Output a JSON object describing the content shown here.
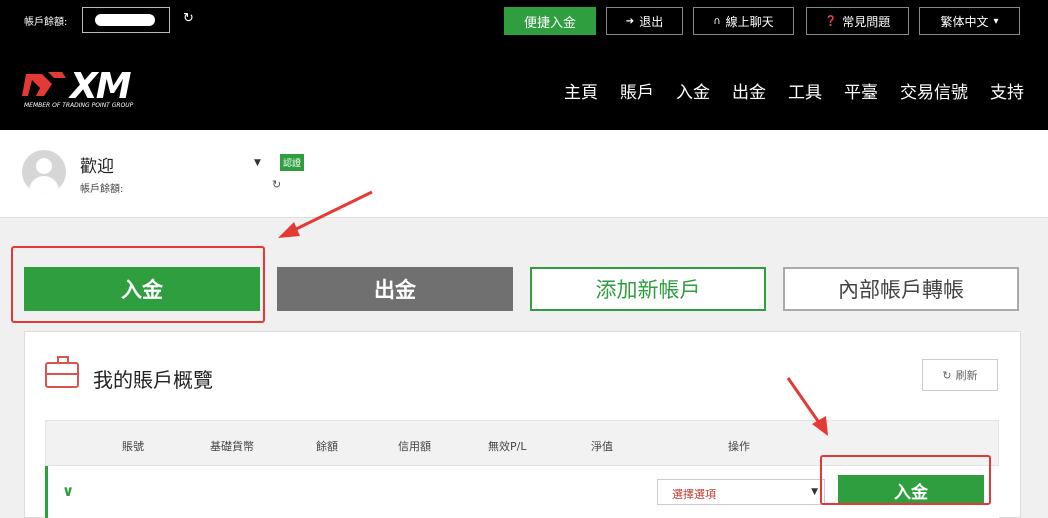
{
  "topbar": {
    "balance_label": "帳戶餘額:",
    "refresh_icon": "refresh-icon",
    "quick_deposit": "便捷入金",
    "logout": "退出",
    "logout_icon": "logout-icon",
    "live_chat": "線上聊天",
    "live_chat_icon": "headset-icon",
    "faq": "常見問題",
    "faq_icon": "question-icon",
    "language": "繁体中文"
  },
  "brand": {
    "logo_text": "XM",
    "tagline": "MEMBER OF TRADING POINT GROUP",
    "accent": "#e53935"
  },
  "nav": {
    "items": [
      "主頁",
      "賬戶",
      "入金",
      "出金",
      "工具",
      "平臺",
      "交易信號",
      "支持"
    ]
  },
  "user": {
    "welcome": "歡迎",
    "account_balance_label": "帳戶餘額:",
    "verified_badge": "認證"
  },
  "actions": {
    "deposit": "入金",
    "withdraw": "出金",
    "add_account": "添加新帳戶",
    "internal_transfer": "內部帳戶轉帳"
  },
  "overview": {
    "title": "我的賬戶概覽",
    "refresh": "刷新",
    "columns": [
      "賬號",
      "基礎貨幣",
      "餘額",
      "信用額",
      "無效P/L",
      "淨值",
      "操作"
    ],
    "row": {
      "select_placeholder": "選擇選項",
      "deposit": "入金"
    }
  },
  "colors": {
    "primary_green": "#2e9e3f",
    "dark_gray": "#707070",
    "highlight_red": "#e53935"
  }
}
